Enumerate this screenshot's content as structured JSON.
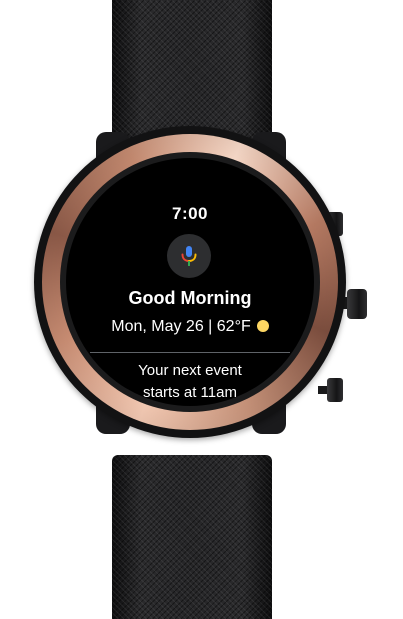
{
  "watch_face": {
    "time": "7:00",
    "assistant_icon": "mic-icon",
    "greeting": "Good Morning",
    "date": "Mon, May 26",
    "separator": "|",
    "temperature": "62°F",
    "weather_icon": "sun-icon",
    "event_line1": "Your next event",
    "event_line2": "starts at 11am"
  },
  "colors": {
    "screen_background": "#000000",
    "text": "#ffffff",
    "bezel": "#c98d73",
    "sun": "#fdd663",
    "mic_blue": "#4285f4",
    "mic_red": "#ea4335",
    "mic_yellow": "#fbbc04",
    "mic_green": "#34a853"
  }
}
